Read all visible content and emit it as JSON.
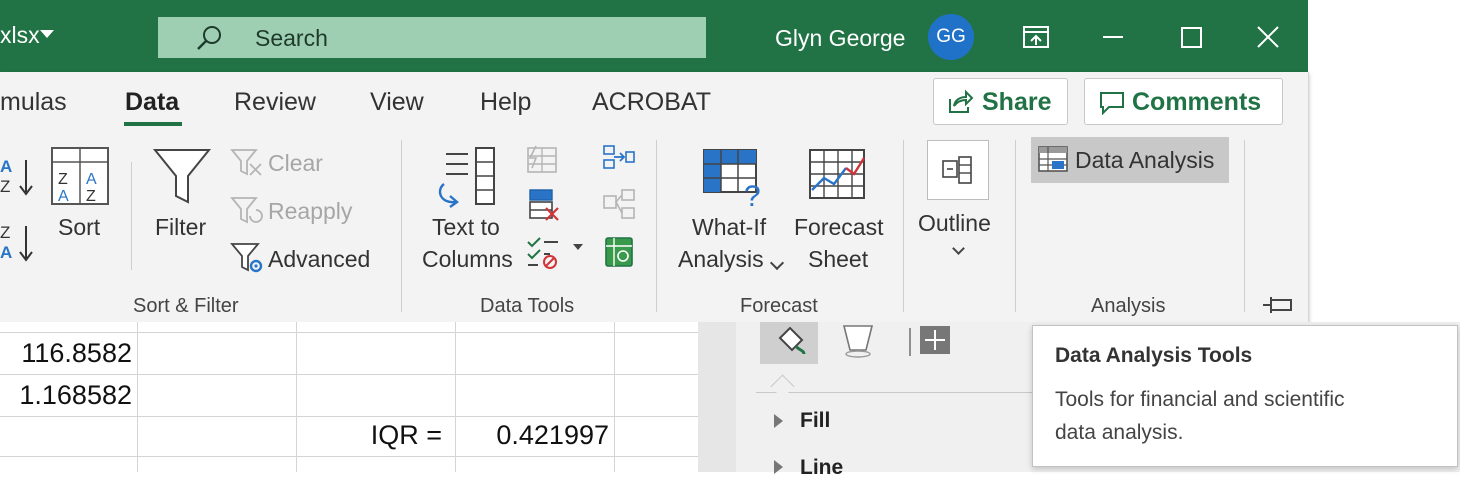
{
  "titlebar": {
    "file_fragment": "xlsx",
    "search_placeholder": "Search",
    "user_name": "Glyn George",
    "user_initials": "GG"
  },
  "tabs": [
    {
      "label": "mulas"
    },
    {
      "label": "Data",
      "active": true
    },
    {
      "label": "Review"
    },
    {
      "label": "View"
    },
    {
      "label": "Help"
    },
    {
      "label": "ACROBAT"
    }
  ],
  "share_label": "Share",
  "comments_label": "Comments",
  "ribbon": {
    "sort_filter": {
      "group_label": "Sort & Filter",
      "sort_label": "Sort",
      "filter_label": "Filter",
      "clear_label": "Clear",
      "reapply_label": "Reapply",
      "advanced_label": "Advanced"
    },
    "data_tools": {
      "group_label": "Data Tools",
      "text_to_columns_line1": "Text to",
      "text_to_columns_line2": "Columns"
    },
    "forecast": {
      "group_label": "Forecast",
      "whatif_line1": "What-If",
      "whatif_line2": "Analysis",
      "forecast_line1": "Forecast",
      "forecast_line2": "Sheet"
    },
    "outline": {
      "label": "Outline"
    },
    "analysis": {
      "group_label": "Analysis",
      "data_analysis_label": "Data Analysis"
    }
  },
  "sheet": {
    "rows": [
      {
        "a": "",
        "c": "",
        "d": ""
      },
      {
        "a": "116.8582",
        "c": "",
        "d": ""
      },
      {
        "a": "1.168582",
        "c": "",
        "d": ""
      },
      {
        "a": "",
        "c": "IQR =",
        "d": "0.421997"
      }
    ]
  },
  "format_pane": {
    "fill_label": "Fill",
    "line_label": "Line"
  },
  "tooltip": {
    "title": "Data Analysis Tools",
    "body_line1": "Tools for financial and scientific",
    "body_line2": "data analysis."
  },
  "colors": {
    "excel_green": "#217346",
    "search_bg": "#9fcfb3",
    "avatar_blue": "#1f72c8",
    "ribbon_bg": "#f3f3f3"
  }
}
